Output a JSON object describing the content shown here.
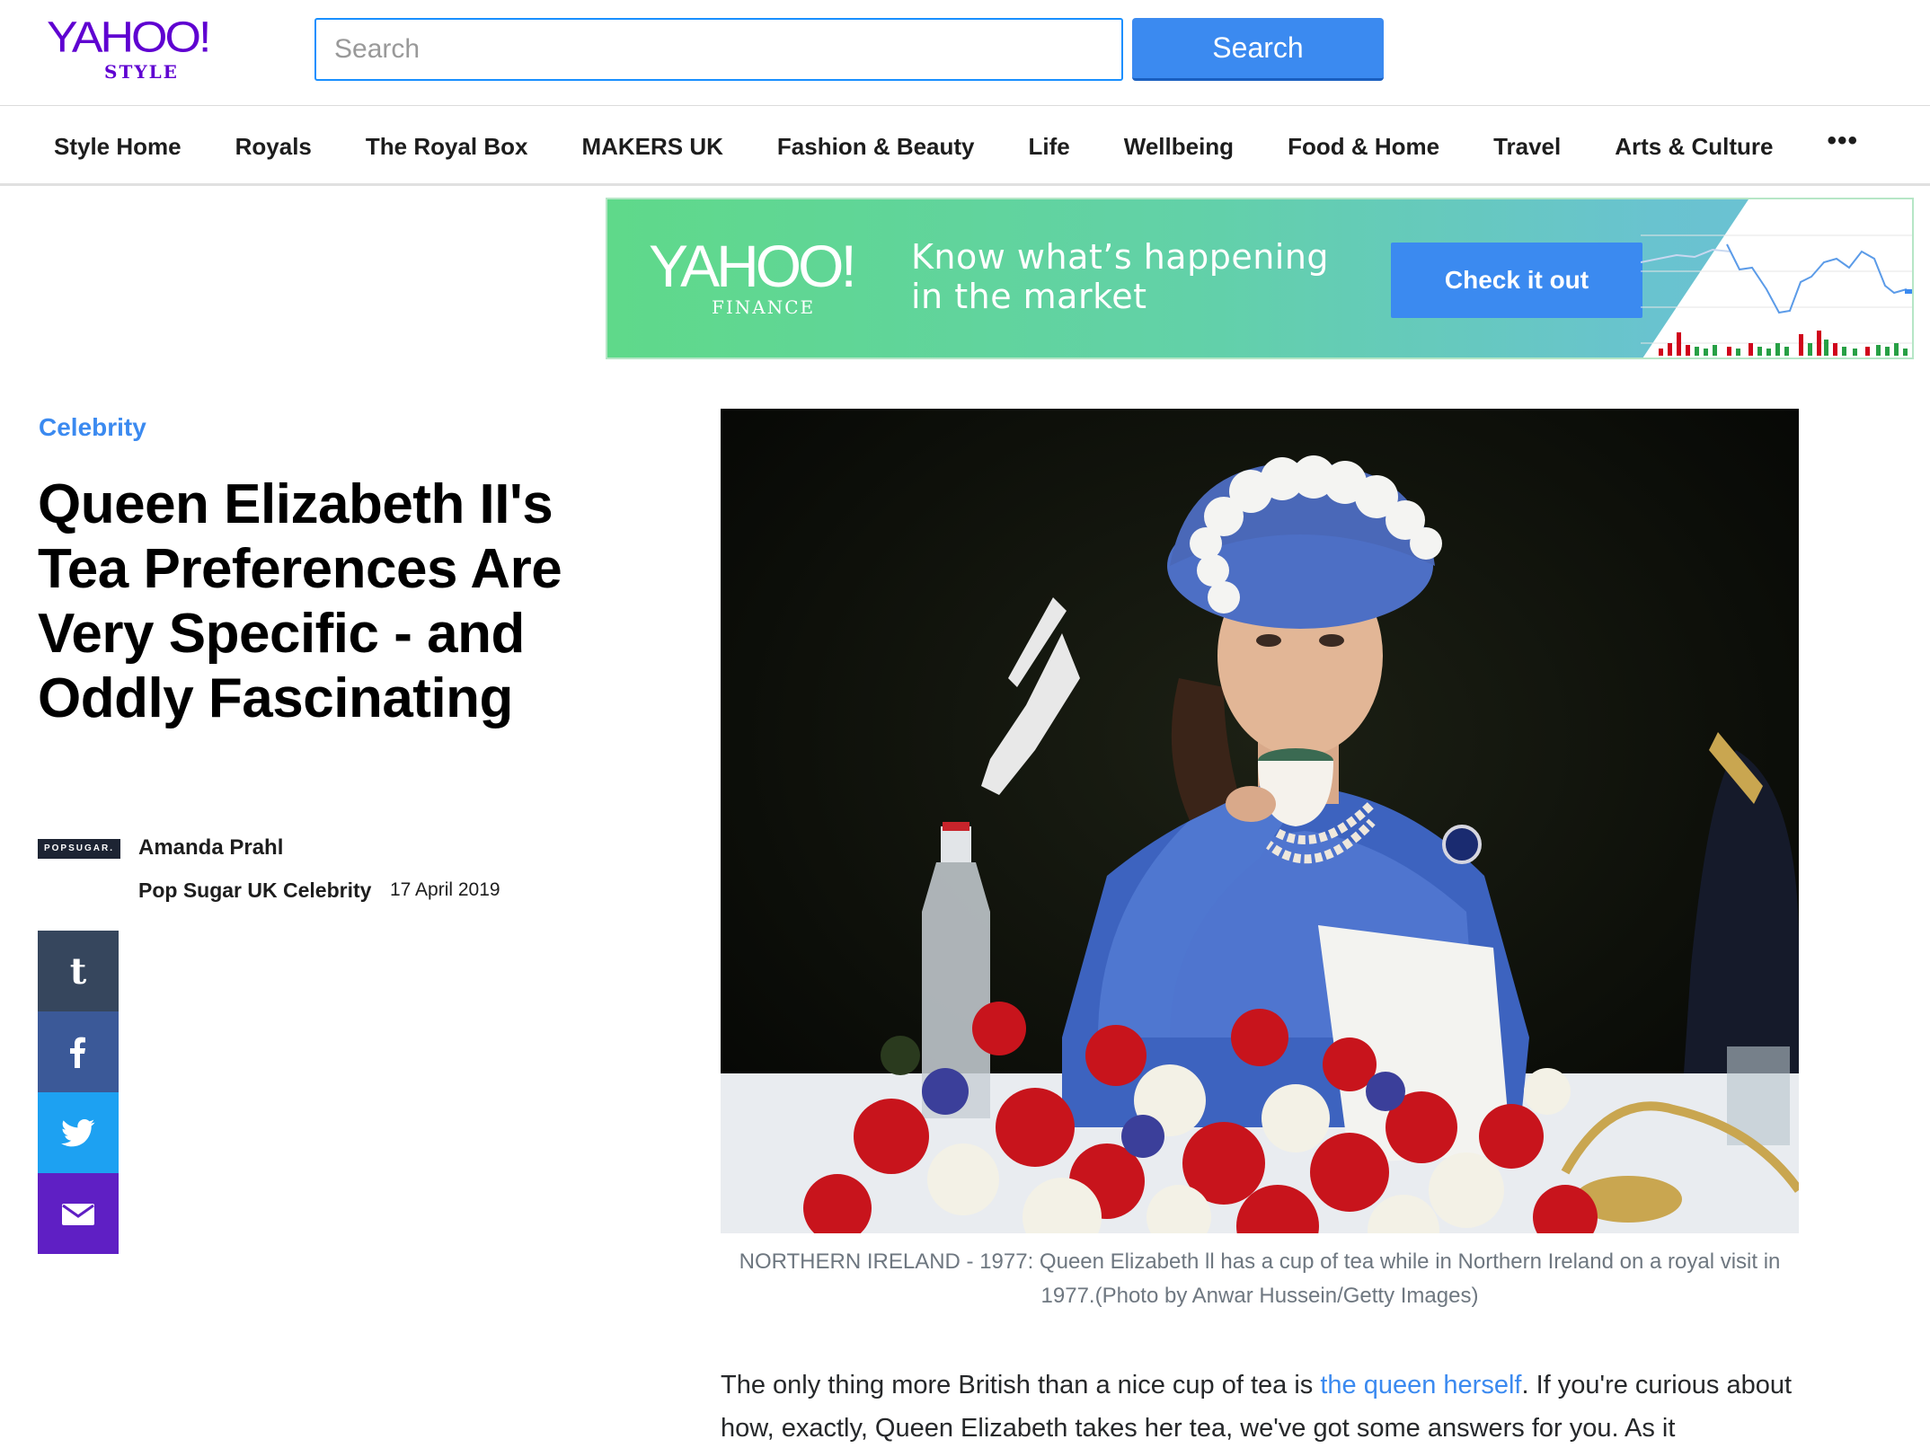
{
  "header": {
    "logo_main": "YAHOO!",
    "logo_sub": "STYLE",
    "search_placeholder": "Search",
    "search_button": "Search"
  },
  "nav": {
    "items": [
      "Style Home",
      "Royals",
      "The Royal Box",
      "MAKERS UK",
      "Fashion & Beauty",
      "Life",
      "Wellbeing",
      "Food & Home",
      "Travel",
      "Arts & Culture"
    ],
    "more": "•••"
  },
  "ad": {
    "logo_main": "YAHOO!",
    "logo_sub": "FINANCE",
    "line1": "Know what’s happening",
    "line2": "in the market",
    "button": "Check it out"
  },
  "article": {
    "category": "Celebrity",
    "headline": "Queen Elizabeth II's Tea Preferences Are Very Specific - and Oddly Fascinating",
    "source_logo": "POPSUGAR.",
    "author": "Amanda Prahl",
    "provider": "Pop Sugar UK Celebrity",
    "date": "17 April 2019",
    "caption": "NORTHERN IRELAND - 1977: Queen Elizabeth ll has a cup of tea while in Northern Ireland on a royal visit in 1977.(Photo by Anwar Hussein/Getty Images)",
    "body_before_link": "The only thing more British than a nice cup of tea is ",
    "body_link": "the queen herself",
    "body_after_link": ". If you're curious about how, exactly, Queen Elizabeth takes her tea, we've got some answers for you. As it"
  },
  "share": [
    {
      "name": "tumblr",
      "icon": "tumblr-icon",
      "color": "#36465d"
    },
    {
      "name": "facebook",
      "icon": "facebook-icon",
      "color": "#3b5998"
    },
    {
      "name": "twitter",
      "icon": "twitter-icon",
      "color": "#1da1f2"
    },
    {
      "name": "mail",
      "icon": "mail-icon",
      "color": "#5f1fc4"
    }
  ],
  "colors": {
    "brand_purple": "#5f01d1",
    "accent_blue": "#3b8af0",
    "link_blue": "#3b8af0"
  }
}
